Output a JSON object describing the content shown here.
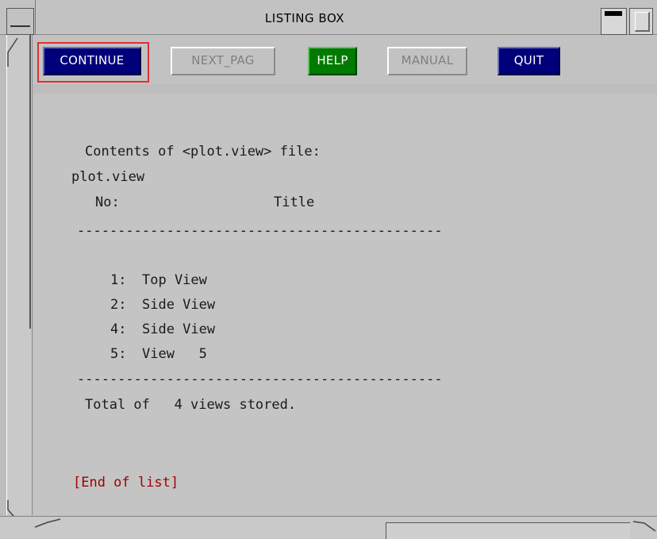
{
  "window": {
    "title": "LISTING BOX"
  },
  "toolbar": {
    "buttons": [
      {
        "label": "CONTINUE",
        "color": "#00007a",
        "state": "active"
      },
      {
        "label": "NEXT_PAG",
        "color": "#c2c2c2",
        "state": "disabled"
      },
      {
        "label": "HELP",
        "color": "#007a00",
        "state": "active"
      },
      {
        "label": "MANUAL",
        "color": "#c2c2c2",
        "state": "disabled"
      },
      {
        "label": "QUIT",
        "color": "#00007a",
        "state": "active"
      }
    ]
  },
  "listing": {
    "header": "Contents of <plot.view> file:",
    "filename": "plot.view",
    "col_no": "No:",
    "col_title": "Title",
    "separator": "---------------------------------------------",
    "rows": [
      {
        "no": "1:",
        "title": "Top View"
      },
      {
        "no": "2:",
        "title": "Side View"
      },
      {
        "no": "4:",
        "title": "Side View"
      },
      {
        "no": "5:",
        "title": "View   5"
      }
    ],
    "total": "Total of   4 views stored.",
    "end": "[End of list]"
  },
  "colors": {
    "accent_blue": "#00007a",
    "accent_green": "#007a00",
    "focus_red": "#e03030",
    "end_text_red": "#a00000",
    "panel_grey": "#c4c4c4"
  }
}
